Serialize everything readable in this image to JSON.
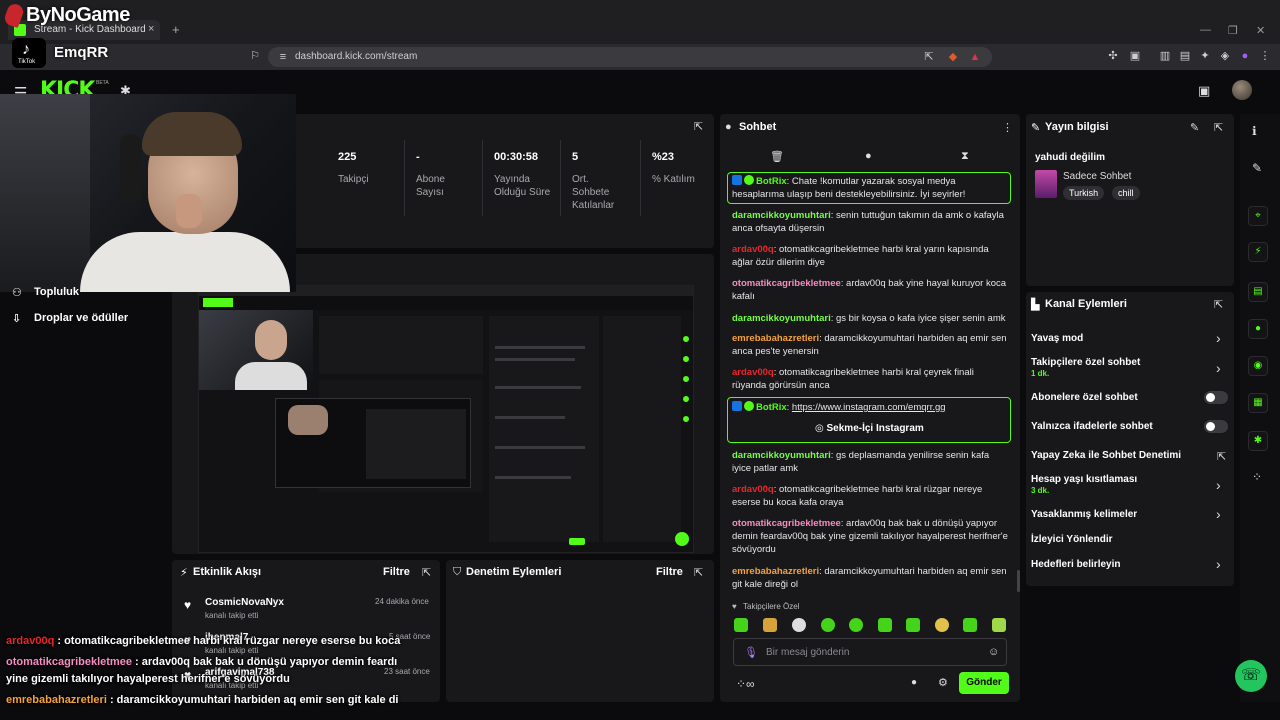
{
  "watermark": {
    "brand": "ByNoGame",
    "tiktok_label": "TikTok",
    "tiktok_user": "EmqRR"
  },
  "browser": {
    "tab_title": "Stream - Kick Dashboard",
    "tab_close": "×",
    "new_tab": "+",
    "url": "dashboard.kick.com/stream"
  },
  "header": {
    "logo": "KICK",
    "beta": "BETA"
  },
  "stats": [
    {
      "value": "225",
      "label": "Takipçi"
    },
    {
      "value": "-",
      "label": "Abone Sayısı"
    },
    {
      "value": "00:30:58",
      "label": "Yayında Olduğu Süre"
    },
    {
      "value": "5",
      "label": "Ort. Sohbete Katılanlar"
    },
    {
      "value": "%23",
      "label": "% Katılım"
    }
  ],
  "nav": {
    "topluluk": "Topluluk",
    "droplar": "Droplar ve ödüller"
  },
  "activity": {
    "title": "Etkinlik Akışı",
    "filter": "Filtre",
    "items": [
      {
        "name": "CosmicNovaNyx",
        "sub": "kanalı takip etti",
        "time": "24 dakika önce"
      },
      {
        "name": "jbenmal7",
        "sub": "kanalı takip etti",
        "time": "5 saat önce"
      },
      {
        "name": "arifgavimal738",
        "sub": "kanalı takip etti",
        "time": "23 saat önce"
      }
    ]
  },
  "moderation": {
    "title": "Denetim Eylemleri",
    "filter": "Filtre"
  },
  "overlay_chat": [
    {
      "user": "ardav00q",
      "text": " : otomatikcagribekletmee harbi kral rüzgar nereye eserse bu koca",
      "color": "#e8262b"
    },
    {
      "user": "otomatikcagribekletmee",
      "text": " : ardav00q bak bak u dönüşü yapıyor demin feardı",
      "color": "#f78dc4"
    },
    {
      "user": "",
      "text": "yine gizemli takılıyor hayalperest herifner'e sövüyordu",
      "color": "#ffffff"
    },
    {
      "user": "emrebabahazretleri",
      "text": " : daramcikkoyumuhtari harbiden aq emir sen git kale di",
      "color": "#f5a23a"
    }
  ],
  "chat": {
    "title": "Sohbet",
    "messages": [
      {
        "user": "BotRix",
        "text": ": Chate !komutlar yazarak sosyal medya hesaplarıma ulaşıp beni destekleyebilirsiniz. İyi seyirler!",
        "color": "#53fc18",
        "bot": true
      },
      {
        "user": "daramcikkoyumuhtari",
        "text": ": senin tuttuğun takımın da amk o kafayla anca ofsayta düşersin",
        "color": "#75fd46"
      },
      {
        "user": "ardav00q",
        "text": ": otomatikcagribekletmee harbi kral yarın kapısında ağlar özür dilerim diye",
        "color": "#e8262b"
      },
      {
        "user": "otomatikcagribekletmee",
        "text": ": ardav00q bak yine hayal kuruyor koca kafalı",
        "color": "#f78dc4"
      },
      {
        "user": "daramcikkoyumuhtari",
        "text": ": gs bir koysa o kafa iyice şişer senin amk",
        "color": "#75fd46"
      },
      {
        "user": "emrebabahazretleri",
        "text": ": daramcikkoyumuhtari harbiden aq emir sen anca pes'te yenersin",
        "color": "#f5a23a"
      },
      {
        "user": "ardav00q",
        "text": ": otomatikcagribekletmee harbi kral çeyrek finali rüyanda görürsün anca",
        "color": "#e8262b"
      },
      {
        "user": "daramcikkoyumuhtari",
        "text": ": gs deplasmanda yenilirse senin kafa iyice patlar amk",
        "color": "#75fd46"
      },
      {
        "user": "ardav00q",
        "text": ": otomatikcagribekletmee harbi kral rüzgar nereye eserse bu koca kafa oraya",
        "color": "#e8262b"
      },
      {
        "user": "otomatikcagribekletmee",
        "text": ": ardav00q bak bak u dönüşü yapıyor demin feardav00q bak yine gizemli takılıyor hayalperest herifner'e sövüyordu",
        "color": "#f78dc4"
      },
      {
        "user": "emrebabahazretleri",
        "text": ": daramcikkoyumuhtari harbiden aq emir sen git kale direği ol",
        "color": "#f5a23a"
      }
    ],
    "botrix_link": {
      "user": "BotRix",
      "colon": ": ",
      "url": "https://www.instagram.com/emqrr.gg",
      "button": "Sekme-İçi Instagram"
    },
    "followers_only": "Takipçilere Özel",
    "input_placeholder": "Bir mesaj gönderin",
    "send": "Gönder"
  },
  "stream_info": {
    "title": "Yayın bilgisi",
    "stream_title": "yahudi değilim",
    "category": "Sadece Sohbet",
    "tags": [
      "Turkish",
      "chill"
    ]
  },
  "channel_actions": {
    "title": "Kanal Eylemleri",
    "items": [
      {
        "label": "Yavaş mod",
        "sub": "",
        "control": "chevron"
      },
      {
        "label": "Takipçilere özel sohbet",
        "sub": "1 dk.",
        "control": "chevron"
      },
      {
        "label": "Abonelere özel sohbet",
        "sub": "",
        "control": "toggle"
      },
      {
        "label": "Yalnızca ifadelerle sohbet",
        "sub": "",
        "control": "toggle"
      },
      {
        "label": "Yapay Zeka ile Sohbet Denetimi",
        "sub": "",
        "control": "external"
      },
      {
        "label": "Hesap yaşı kısıtlaması",
        "sub": "3 dk.",
        "control": "chevron"
      },
      {
        "label": "Yasaklanmış kelimeler",
        "sub": "",
        "control": "chevron"
      },
      {
        "label": "İzleyici Yönlendir",
        "sub": "",
        "control": "none"
      },
      {
        "label": "Hedefleri belirleyin",
        "sub": "",
        "control": "chevron"
      }
    ]
  },
  "colors": {
    "accent": "#53fc18",
    "panel": "#18181b",
    "bg": "#0b0b0d"
  }
}
